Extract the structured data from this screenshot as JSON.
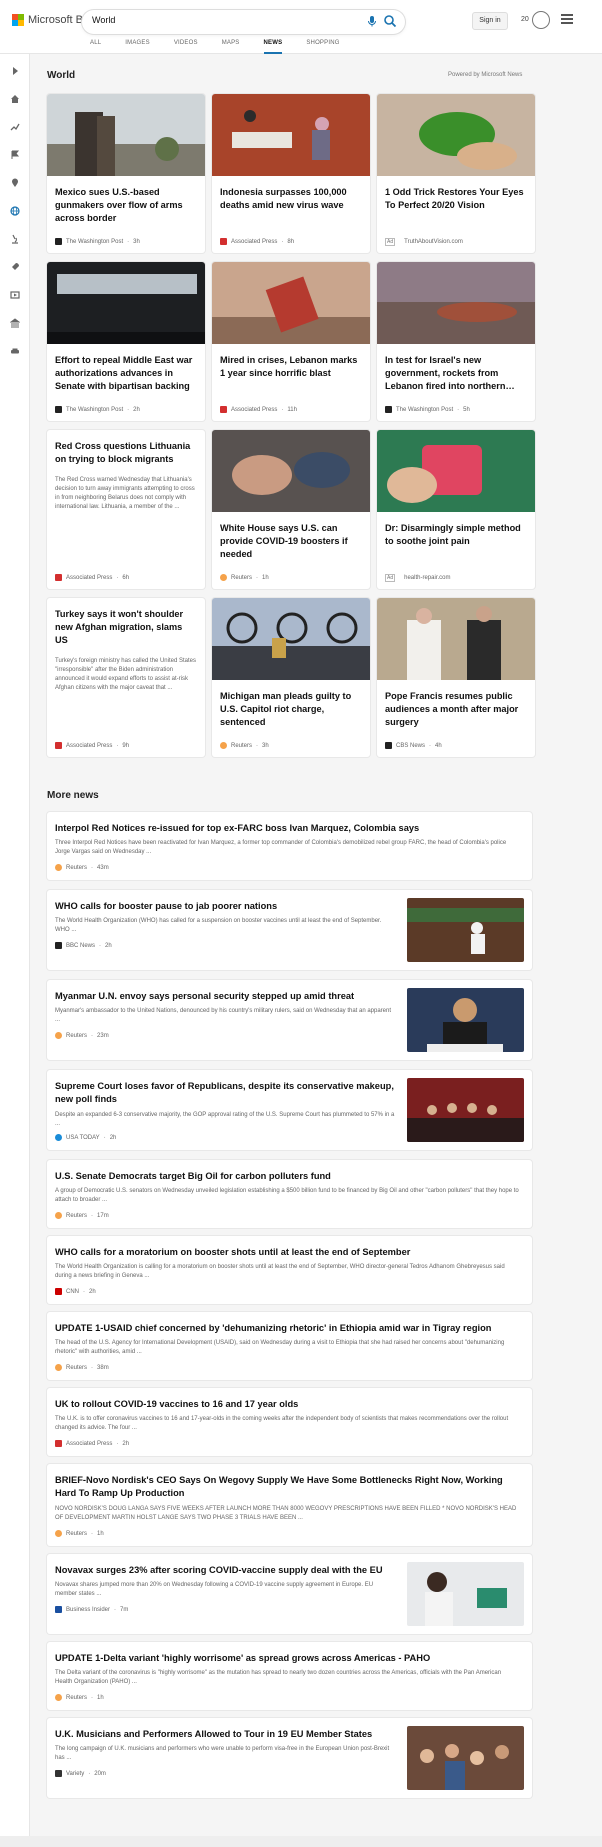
{
  "header": {
    "brand": "Microsoft Bing",
    "search_value": "World",
    "signin_label": "Sign in",
    "rewards_count": "20",
    "scopes": [
      "ALL",
      "IMAGES",
      "VIDEOS",
      "MAPS",
      "NEWS",
      "SHOPPING"
    ],
    "active_scope": "NEWS"
  },
  "world": {
    "title": "World",
    "powered_by": "Powered by Microsoft News",
    "cards": [
      {
        "title": "Mexico sues U.S.-based gunmakers over flow of arms across border",
        "source": "The Washington Post",
        "age": "3h"
      },
      {
        "title": "Indonesia surpasses 100,000 deaths amid new virus wave",
        "source": "Associated Press",
        "age": "8h"
      },
      {
        "title": "1 Odd Trick Restores Your Eyes To Perfect 20/20 Vision",
        "ad": "Ad",
        "source": "TruthAboutVision.com"
      },
      {
        "title": "Effort to repeal Middle East war authorizations advances in Senate with bipartisan backing",
        "source": "The Washington Post",
        "age": "2h"
      },
      {
        "title": "Mired in crises, Lebanon marks 1 year since horrific blast",
        "source": "Associated Press",
        "age": "11h"
      },
      {
        "title": "In test for Israel's new government, rockets from Lebanon fired into northern…",
        "source": "The Washington Post",
        "age": "5h"
      },
      {
        "title": "Red Cross questions Lithuania on trying to block migrants",
        "summary": "The Red Cross warned Wednesday that Lithuania's decision to turn away immigrants attempting to cross in from neighboring Belarus does not comply with international law. Lithuania, a member of the ...",
        "source": "Associated Press",
        "age": "6h"
      },
      {
        "title": "White House says U.S. can provide COVID-19 boosters if needed",
        "source": "Reuters",
        "age": "1h"
      },
      {
        "title": "Dr: Disarmingly simple method to soothe joint pain",
        "ad": "Ad",
        "source": "health-repair.com"
      },
      {
        "title": "Turkey says it won't shoulder new Afghan migration, slams US",
        "summary": "Turkey's foreign ministry has called the United States \"irresponsible\" after the Biden administration announced it would expand efforts to assist at-risk Afghan citizens with the major caveat that ...",
        "source": "Associated Press",
        "age": "9h"
      },
      {
        "title": "Michigan man pleads guilty to U.S. Capitol riot charge, sentenced",
        "source": "Reuters",
        "age": "3h"
      },
      {
        "title": "Pope Francis resumes public audiences a month after major surgery",
        "source": "CBS News",
        "age": "4h"
      }
    ]
  },
  "more_news": {
    "title": "More news",
    "items": [
      {
        "title": "Interpol Red Notices re-issued for top ex-FARC boss Ivan Marquez, Colombia says",
        "summary": "Three Interpol Red Notices have been reactivated for Ivan Marquez, a former top commander of Colombia's demobilized rebel group FARC, the head of Colombia's police Jorge Vargas said on Wednesday ...",
        "source": "Reuters",
        "age": "43m"
      },
      {
        "title": "WHO calls for booster pause to jab poorer nations",
        "summary": "The World Health Organization (WHO) has called for a suspension on booster vaccines until at least the end of September. WHO ...",
        "source": "BBC News",
        "age": "2h"
      },
      {
        "title": "Myanmar U.N. envoy says personal security stepped up amid threat",
        "summary": "Myanmar's ambassador to the United Nations, denounced by his country's military rulers, said on Wednesday that an apparent ...",
        "source": "Reuters",
        "age": "23m"
      },
      {
        "title": "Supreme Court loses favor of Republicans, despite its conservative makeup, new poll finds",
        "summary": "Despite an expanded 6-3 conservative majority, the GOP approval rating of the U.S. Supreme Court has plummeted to 57% in a ...",
        "source": "USA TODAY",
        "age": "2h"
      },
      {
        "title": "U.S. Senate Democrats target Big Oil for carbon polluters fund",
        "summary": "A group of Democratic U.S. senators on Wednesday unveiled legislation establishing a $500 billion fund to be financed by Big Oil and other \"carbon polluters\" that they hope to attach to broader ...",
        "source": "Reuters",
        "age": "17m"
      },
      {
        "title": "WHO calls for a moratorium on booster shots until at least the end of September",
        "summary": "The World Health Organization is calling for a moratorium on booster shots until at least the end of September, WHO director-general Tedros Adhanom Ghebreyesus said during a news briefing in Geneva ...",
        "source": "CNN",
        "age": "2h"
      },
      {
        "title": "UPDATE 1-USAID chief concerned by 'dehumanizing rhetoric' in Ethiopia amid war in Tigray region",
        "summary": "The head of the U.S. Agency for International Development (USAID), said on Wednesday during a visit to Ethiopia that she had raised her concerns about \"dehumanizing rhetoric\" with authorities, amid ...",
        "source": "Reuters",
        "age": "38m"
      },
      {
        "title": "UK to rollout COVID-19 vaccines to 16 and 17 year olds",
        "summary": "The U.K. is to offer coronavirus vaccines to 16 and 17-year-olds in the coming weeks after the independent body of scientists that makes recommendations over the rollout changed its advice. The four ...",
        "source": "Associated Press",
        "age": "2h"
      },
      {
        "title": "BRIEF-Novo Nordisk's CEO Says On Wegovy Supply We Have Some Bottlenecks Right Now, Working Hard To Ramp Up Production",
        "summary": "NOVO NORDISK'S DOUG LANGA SAYS FIVE WEEKS AFTER LAUNCH MORE THAN 8000 WEGOVY PRESCRIPTIONS HAVE BEEN FILLED * NOVO NORDISK'S HEAD OF DEVELOPMENT MARTIN HOLST LANGE SAYS TWO PHASE 3 TRIALS HAVE BEEN ...",
        "source": "Reuters",
        "age": "1h"
      },
      {
        "title": "Novavax surges 23% after scoring COVID-vaccine supply deal with the EU",
        "summary": "Novavax shares jumped more than 20% on Wednesday following a COVID-19 vaccine supply agreement in Europe. EU member states ...",
        "source": "Business Insider",
        "age": "7m"
      },
      {
        "title": "UPDATE 1-Delta variant 'highly worrisome' as spread grows across Americas - PAHO",
        "summary": "The Delta variant of the coronavirus is \"highly worrisome\" as the mutation has spread to nearly two dozen countries across the Americas, officials with the Pan American Health Organization (PAHO) ...",
        "source": "Reuters",
        "age": "1h"
      },
      {
        "title": "U.K. Musicians and Performers Allowed to Tour in 19 EU Member States",
        "summary": "The long campaign of U.K. musicians and performers who were unable to perform visa-free in the European Union post-Brexit has ...",
        "source": "Variety",
        "age": "20m"
      }
    ]
  },
  "colors": {
    "accent": "#1a73b0",
    "reuters": "#f5a24a",
    "ap": "#d32f2f"
  }
}
